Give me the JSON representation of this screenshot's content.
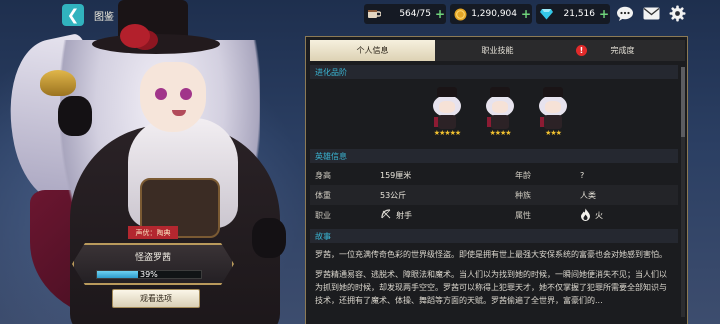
{
  "header": {
    "title": "图鉴",
    "back_icon": "back-arrow-icon"
  },
  "resources": [
    {
      "icon": "coffee-cup-icon",
      "value": "564/75"
    },
    {
      "icon": "gold-coin-icon",
      "value": "1,290,904"
    },
    {
      "icon": "diamond-gem-icon",
      "value": "21,516"
    }
  ],
  "toolbar_icons": [
    "chat-icon",
    "mail-icon",
    "settings-gear-icon"
  ],
  "character": {
    "role_tag": "声优：陶典",
    "name": "怪盗罗茜",
    "progress": 0.39,
    "progress_label": "39%",
    "view_button": "观看选项"
  },
  "tabs": [
    {
      "label": "个人信息",
      "active": true
    },
    {
      "label": "职业技能",
      "active": false
    },
    {
      "label": "完成度",
      "active": false,
      "alert": "!"
    }
  ],
  "evolution": {
    "title": "进化品阶",
    "stages": [
      {
        "stars": "★★★★★",
        "count": 5
      },
      {
        "stars": "★★★★",
        "count": 4
      },
      {
        "stars": "★★★",
        "count": 3
      }
    ]
  },
  "hero_info": {
    "title": "英雄信息",
    "rows": [
      {
        "k1": "身高",
        "v1": "159厘米",
        "k2": "年龄",
        "v2": "?"
      },
      {
        "k1": "体重",
        "v1": "53公斤",
        "k2": "种族",
        "v2": "人类"
      },
      {
        "k1": "职业",
        "v1": "射手",
        "v1_icon": "bow-archer-icon",
        "k2": "属性",
        "v2": "火",
        "v2_icon": "fire-icon"
      }
    ]
  },
  "story": {
    "title": "故事",
    "paragraphs": [
      "罗茜，一位充满传奇色彩的世界级怪盗。即使是拥有世上最强大安保系统的富豪也会对她感到害怕。",
      "罗茜精通易容、逃脱术、障眼法和魔术。当人们以为找到她的时候，一瞬间她便消失不见；当人们以为抓到她的时候，却发现两手空空。罗茜可以称得上犯罪天才，她不仅掌握了犯罪所需要全部知识与技术，还拥有了魔术、体操、舞蹈等方面的天赋。罗茜偷遍了全世界，富豪们的..."
    ]
  },
  "colors": {
    "accent_cyan": "#31b3be",
    "section_header": "#3ab6d4",
    "progress_fill": "#4bb8e0",
    "tab_active": "#f6f0de",
    "alert_red": "#e12a2a",
    "star_gold": "#f2c230"
  }
}
